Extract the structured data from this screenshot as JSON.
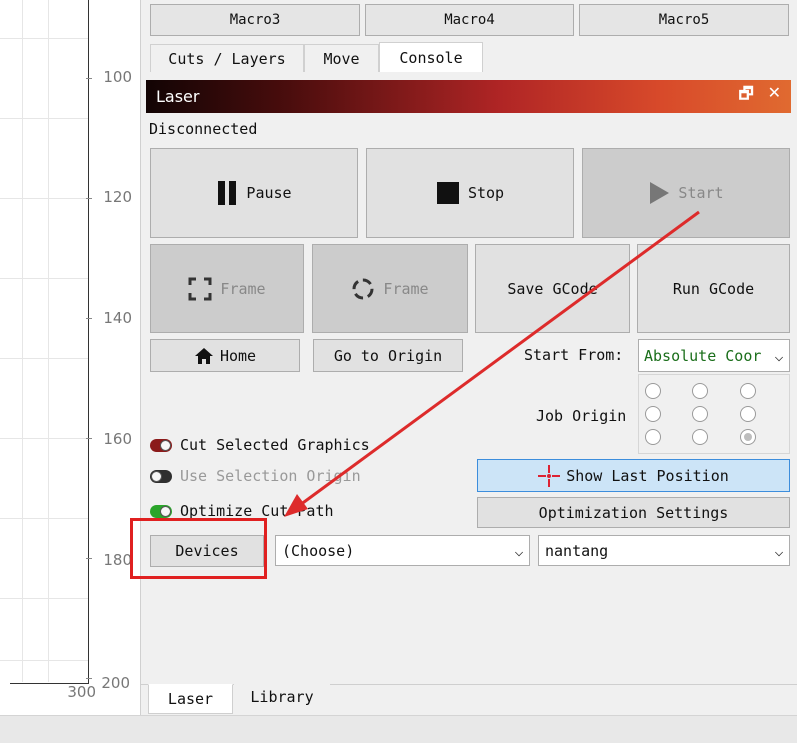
{
  "ruler": {
    "ticks": [
      "100",
      "120",
      "140",
      "160",
      "180",
      "200"
    ],
    "x_label": "300"
  },
  "macros": [
    "Macro3",
    "Macro4",
    "Macro5"
  ],
  "top_tabs": [
    {
      "label": "Cuts / Layers",
      "active": false
    },
    {
      "label": "Move",
      "active": false
    },
    {
      "label": "Console",
      "active": true
    }
  ],
  "laser": {
    "title": "Laser",
    "status": "Disconnected",
    "pause_label": "Pause",
    "stop_label": "Stop",
    "start_label": "Start",
    "frame1_label": "Frame",
    "frame2_label": "Frame",
    "save_gcode_label": "Save GCode",
    "run_gcode_label": "Run GCode",
    "home_label": "Home",
    "go_origin_label": "Go to Origin",
    "start_from_label": "Start From:",
    "start_from_value": "Absolute Coor",
    "job_origin_label": "Job Origin",
    "job_origin_selected": "bottom-right",
    "cut_selected_label": "Cut Selected Graphics",
    "use_selection_origin_label": "Use Selection Origin",
    "optimize_cut_path_label": "Optimize Cut Path",
    "show_last_position_label": "Show Last Position",
    "optimization_settings_label": "Optimization Settings",
    "devices_label": "Devices",
    "device_choose_value": "(Choose)",
    "device_name_value": "nantang"
  },
  "bottom_tabs": [
    {
      "label": "Laser",
      "active": true
    },
    {
      "label": "Library",
      "active": false
    }
  ],
  "colors": {
    "toggle_cut_selected": "#8b1a1a",
    "toggle_use_selection": "#2f2f2f",
    "toggle_optimize": "#2aa52a",
    "highlight_box": "#e02020",
    "arrow": "#dd2b2b",
    "show_last_bg": "#cce4f7",
    "show_last_border": "#3c8ddc"
  }
}
